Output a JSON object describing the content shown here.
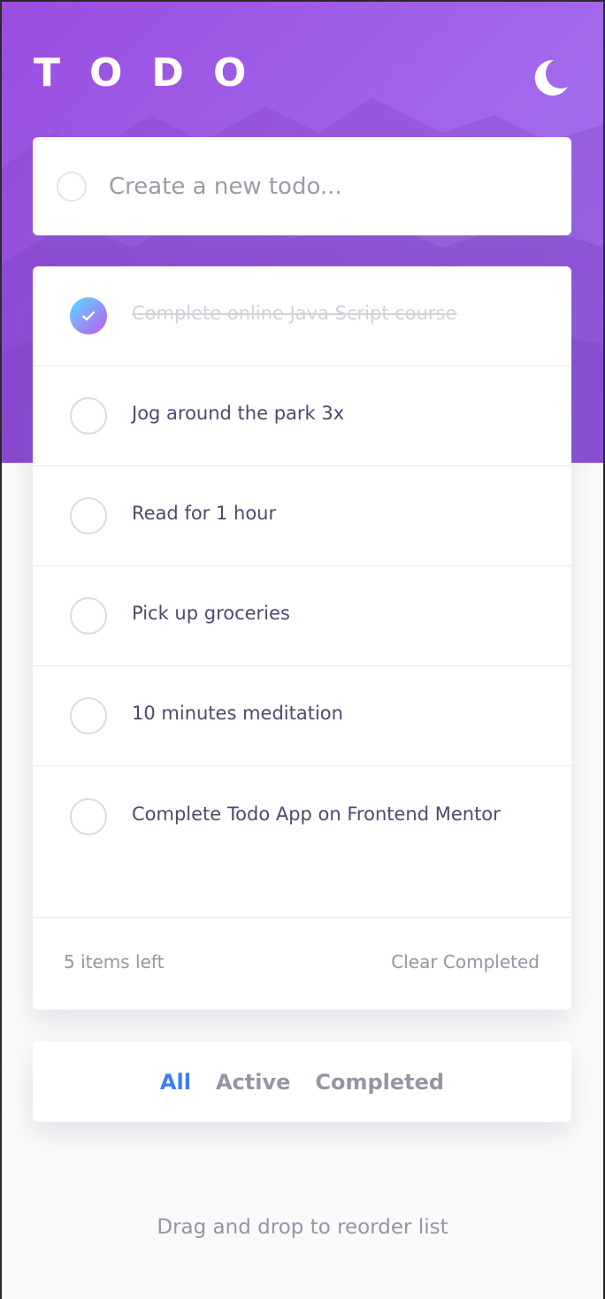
{
  "app": {
    "title": "TODO"
  },
  "theme_toggle": {
    "icon": "moon-icon"
  },
  "new_todo": {
    "placeholder": "Create a new todo..."
  },
  "todos": [
    {
      "text": "Complete online Java Script course",
      "completed": true
    },
    {
      "text": "Jog around the park 3x",
      "completed": false
    },
    {
      "text": "Read for 1 hour",
      "completed": false
    },
    {
      "text": "Pick up groceries",
      "completed": false
    },
    {
      "text": "10 minutes meditation",
      "completed": false
    },
    {
      "text": "Complete Todo App on Frontend Mentor",
      "completed": false
    }
  ],
  "footer": {
    "items_left": "5 items left",
    "clear_label": "Clear Completed"
  },
  "filters": [
    {
      "label": "All",
      "active": true
    },
    {
      "label": "Active",
      "active": false
    },
    {
      "label": "Completed",
      "active": false
    }
  ],
  "hint": "Drag and drop to reorder list",
  "colors": {
    "accent": "#3a7cfd",
    "hero_gradient_start": "#9b4de0",
    "hero_gradient_end": "#9b7bf0",
    "check_gradient_start": "#57ddff",
    "check_gradient_end": "#c058f3"
  }
}
